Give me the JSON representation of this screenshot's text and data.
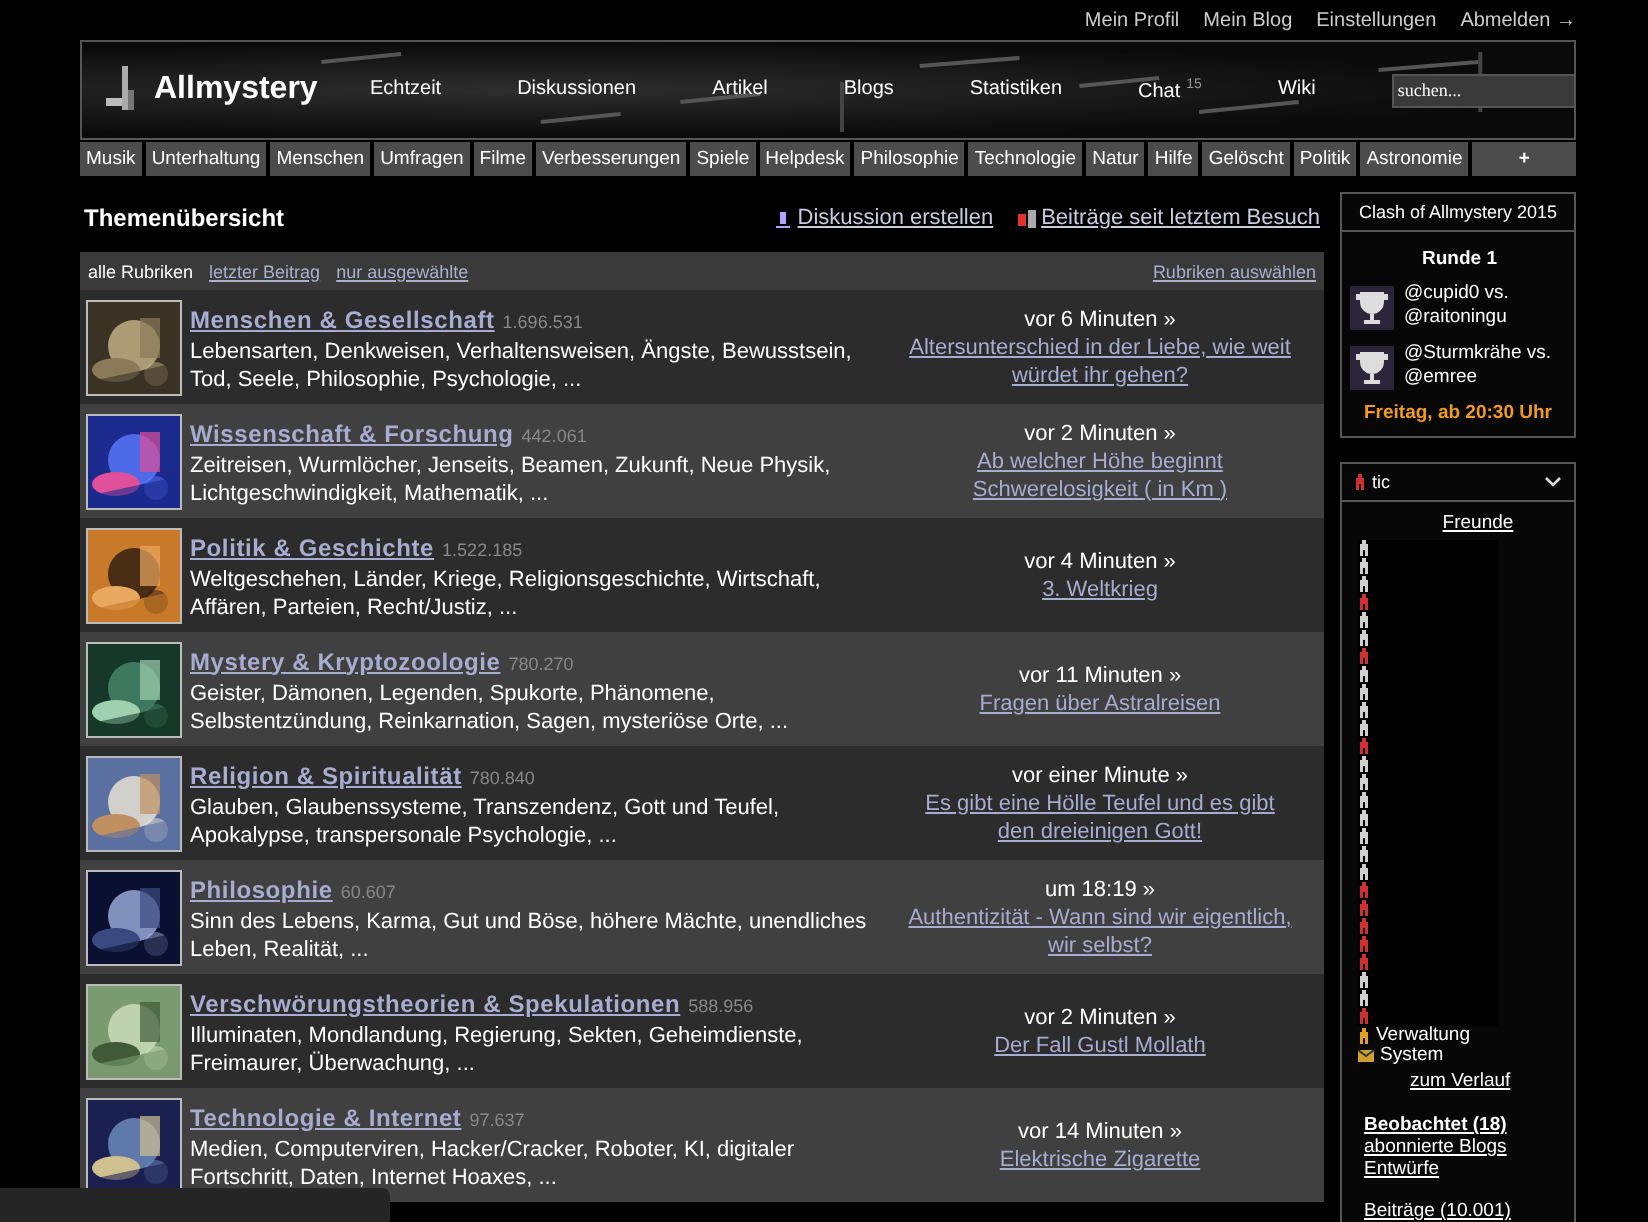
{
  "user_links": [
    "Mein Profil",
    "Mein Blog",
    "Einstellungen",
    "Abmelden →"
  ],
  "header": {
    "logo": "Allmystery",
    "nav": [
      {
        "label": "Echtzeit"
      },
      {
        "label": "Diskussionen"
      },
      {
        "label": "Artikel"
      },
      {
        "label": "Blogs"
      },
      {
        "label": "Statistiken"
      },
      {
        "label": "Chat",
        "badge": "15"
      },
      {
        "label": "Wiki"
      }
    ],
    "search": {
      "placeholder": "suchen..."
    }
  },
  "categories": [
    "Musik",
    "Unterhaltung",
    "Menschen",
    "Umfragen",
    "Filme",
    "Verbesserungen",
    "Spiele",
    "Helpdesk",
    "Philosophie",
    "Technologie",
    "Natur",
    "Hilfe",
    "Gelöscht",
    "Politik",
    "Astronomie",
    "+"
  ],
  "overview": {
    "title": "Themenübersicht",
    "actions": [
      "Diskussion erstellen",
      "Beiträge seit letztem Besuch"
    ],
    "filters": [
      {
        "label": "alle Rubriken",
        "selected": true
      },
      {
        "label": "letzter Beitrag",
        "selected": false
      },
      {
        "label": "nur ausgewählte",
        "selected": false
      }
    ],
    "choose_link": "Rubriken auswählen",
    "rows": [
      {
        "title": "Menschen & Gesellschaft",
        "count": "1.696.531",
        "description": "Lebensarten, Denkweisen, Verhaltensweisen, Ängste, Bewusstsein, Tod, Seele, Philosophie, Psychologie, ...",
        "time": "vor 6 Minuten »",
        "last_post": "Altersunterschied in der Liebe, wie weit würdet ihr gehen?"
      },
      {
        "title": "Wissenschaft & Forschung",
        "count": "442.061",
        "description": "Zeitreisen, Wurmlöcher, Jenseits, Beamen, Zukunft, Neue Physik, Lichtgeschwindigkeit, Mathematik, ...",
        "time": "vor 2 Minuten »",
        "last_post": "Ab welcher Höhe beginnt Schwerelosigkeit ( in Km )"
      },
      {
        "title": "Politik & Geschichte",
        "count": "1.522.185",
        "description": "Weltgeschehen, Länder, Kriege, Religionsgeschichte, Wirtschaft, Affären, Parteien, Recht/Justiz, ...",
        "time": "vor 4 Minuten »",
        "last_post": "3. Weltkrieg"
      },
      {
        "title": "Mystery & Kryptozoologie",
        "count": "780.270",
        "description": "Geister, Dämonen, Legenden, Spukorte, Phänomene, Selbstentzündung, Reinkarnation, Sagen, mysteriöse Orte, ...",
        "time": "vor 11 Minuten »",
        "last_post": "Fragen über Astralreisen"
      },
      {
        "title": "Religion & Spiritualität",
        "count": "780.840",
        "description": "Glauben, Glaubenssysteme, Transzendenz, Gott und Teufel, Apokalypse, transpersonale Psychologie, ...",
        "time": "vor einer Minute »",
        "last_post": "Es gibt eine Hölle Teufel und es gibt den dreieinigen Gott!"
      },
      {
        "title": "Philosophie",
        "count": "60.607",
        "description": "Sinn des Lebens, Karma, Gut und Böse, höhere Mächte, unendliches Leben, Realität, ...",
        "time": "um 18:19 »",
        "last_post": "Authentizität - Wann sind wir eigentlich, wir selbst?"
      },
      {
        "title": "Verschwörungstheorien & Spekulationen",
        "count": "588.956",
        "description": "Illuminaten, Mondlandung, Regierung, Sekten, Geheimdienste, Freimaurer, Überwachung, ...",
        "time": "vor 2 Minuten »",
        "last_post": "Der Fall Gustl Mollath"
      },
      {
        "title": "Technologie & Internet",
        "count": "97.637",
        "description": "Medien, Computerviren, Hacker/Cracker, Roboter, KI, digitaler Fortschritt, Daten, Internet Hoaxes, ...",
        "time": "vor 14 Minuten »",
        "last_post": "Elektrische Zigarette"
      }
    ]
  },
  "clash": {
    "title": "Clash of Allmystery 2015",
    "round": "Runde 1",
    "matches": [
      {
        "players": "@cupid0 vs. @raitoningu"
      },
      {
        "players": "@Sturmkrähe vs. @emree"
      }
    ],
    "date": "Freitag, ab 20:30 Uhr"
  },
  "user_box": {
    "name": "tic",
    "friends_link": "Freunde",
    "friends": [
      {
        "color": "#d0d0d0"
      },
      {
        "color": "#d0d0d0"
      },
      {
        "color": "#d0d0d0"
      },
      {
        "color": "#d03030"
      },
      {
        "color": "#d0d0d0"
      },
      {
        "color": "#d0d0d0"
      },
      {
        "color": "#d03030"
      },
      {
        "color": "#d0d0d0"
      },
      {
        "color": "#d0d0d0"
      },
      {
        "color": "#d0d0d0"
      },
      {
        "color": "#d0d0d0"
      },
      {
        "color": "#d03030"
      },
      {
        "color": "#d0d0d0"
      },
      {
        "color": "#d0d0d0"
      },
      {
        "color": "#d0d0d0"
      },
      {
        "color": "#d0d0d0"
      },
      {
        "color": "#d0d0d0"
      },
      {
        "color": "#d0d0d0"
      },
      {
        "color": "#d0d0d0"
      },
      {
        "color": "#d03030"
      },
      {
        "color": "#d03030"
      },
      {
        "color": "#d03030"
      },
      {
        "color": "#d03030"
      },
      {
        "color": "#d03030"
      },
      {
        "color": "#d0d0d0"
      },
      {
        "color": "#d0d0d0"
      },
      {
        "color": "#d03030"
      }
    ],
    "notices": [
      {
        "kind": "person",
        "label": "Verwaltung"
      },
      {
        "kind": "mail",
        "label": "System"
      }
    ],
    "history_link": "zum Verlauf",
    "links": [
      {
        "label": "Beobachtet (18)",
        "bold": true
      },
      {
        "label": "abonnierte Blogs",
        "bold": false
      },
      {
        "label": "Entwürfe",
        "bold": false
      }
    ],
    "posts_link": "Beiträge (10.001)"
  }
}
